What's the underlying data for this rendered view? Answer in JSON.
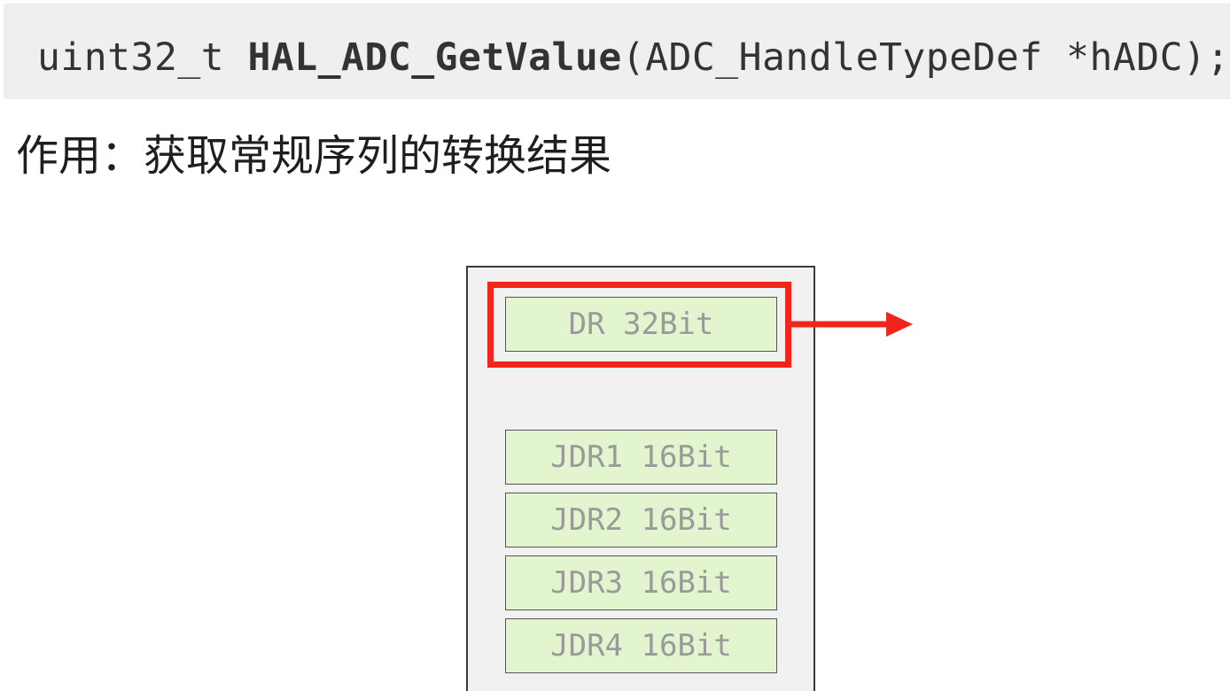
{
  "code": {
    "return_type": "uint32_t ",
    "function_name": "HAL_ADC_GetValue",
    "params": "(ADC_HandleTypeDef *hADC);"
  },
  "description": "作用：获取常规序列的转换结果",
  "registers": {
    "dr": "DR 32Bit",
    "jdr1": "JDR1 16Bit",
    "jdr2": "JDR2 16Bit",
    "jdr3": "JDR3 16Bit",
    "jdr4": "JDR4 16Bit"
  },
  "colors": {
    "highlight": "#f0261e",
    "register_fill": "#e2f5cf",
    "container_fill": "#f1f1f1",
    "code_background": "#efefef"
  }
}
